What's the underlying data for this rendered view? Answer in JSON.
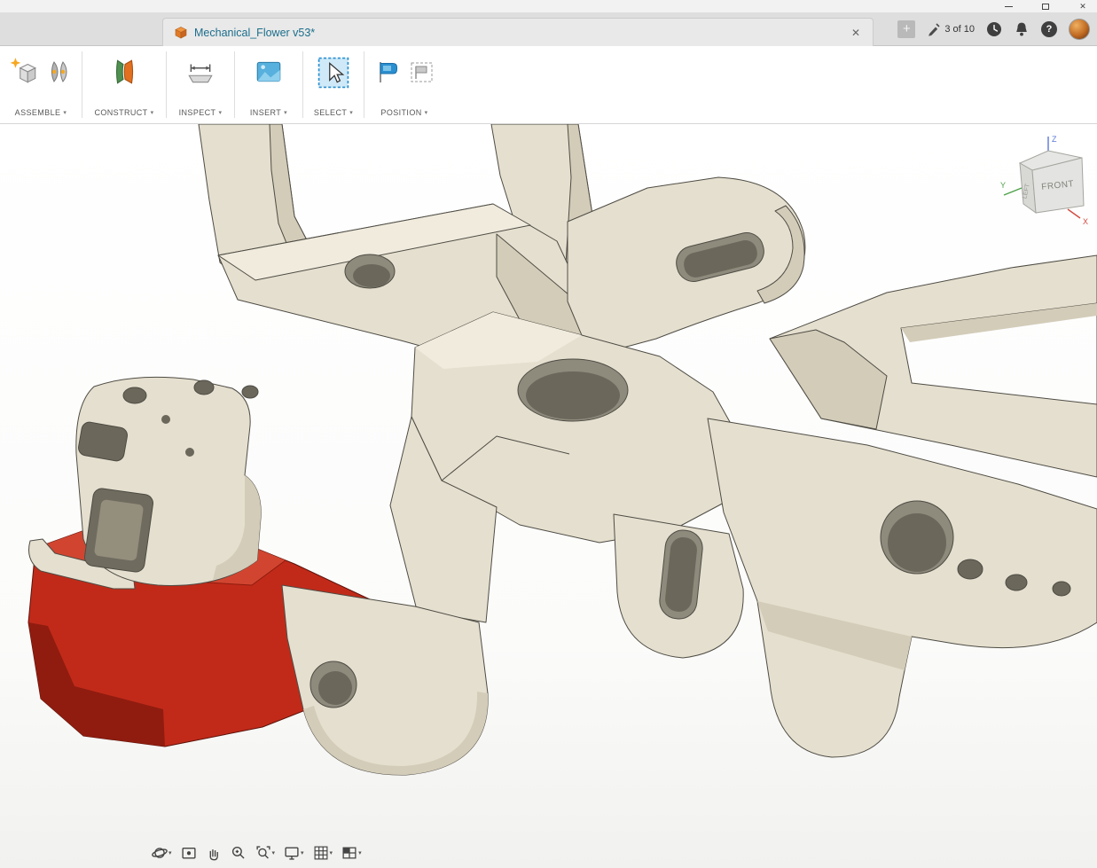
{
  "glyphs": {
    "caret_down": "▾",
    "close": "✕",
    "plus": "+",
    "question": "?"
  },
  "tab_bar": {
    "document_title": "Mechanical_Flower v53*",
    "job_status": "3 of 10"
  },
  "toolbar": {
    "groups": [
      {
        "label": "ASSEMBLE"
      },
      {
        "label": "CONSTRUCT"
      },
      {
        "label": "INSPECT"
      },
      {
        "label": "INSERT"
      },
      {
        "label": "SELECT"
      },
      {
        "label": "POSITION"
      }
    ]
  },
  "viewcube": {
    "front": "FRONT",
    "left": "LEFT",
    "axis_x": "X",
    "axis_y": "Y",
    "axis_z": "Z"
  },
  "nav_bar": {
    "items": [
      {
        "name": "orbit",
        "caret": true
      },
      {
        "name": "look-at",
        "caret": false
      },
      {
        "name": "pan",
        "caret": false
      },
      {
        "name": "zoom",
        "caret": false
      },
      {
        "name": "fit",
        "caret": true
      },
      {
        "name": "display-settings",
        "caret": true
      },
      {
        "name": "grid-and-snaps",
        "caret": true
      },
      {
        "name": "viewports",
        "caret": true
      }
    ]
  },
  "colors": {
    "model_body": "#e5dfcf",
    "model_accent_red": "#c12a19",
    "selection_blue": "#2a8fd0",
    "document_title": "#1b6e8c"
  }
}
